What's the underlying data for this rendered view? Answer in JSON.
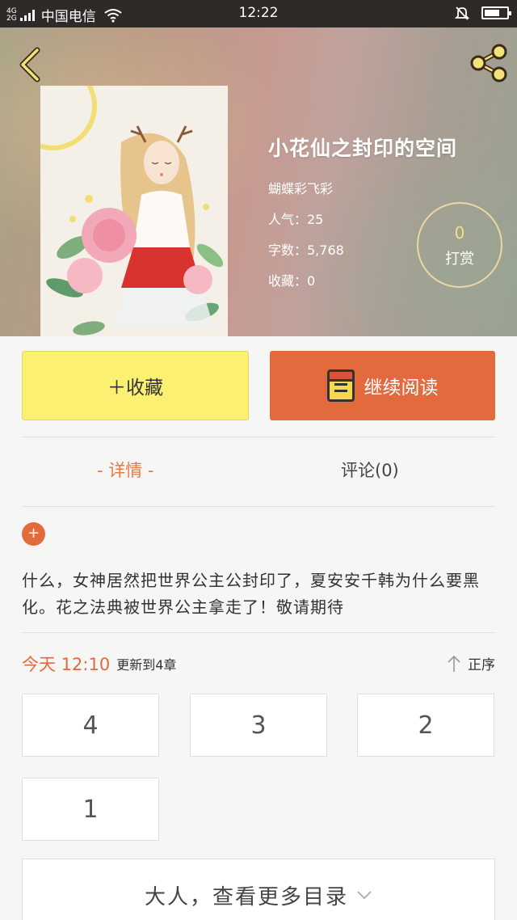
{
  "status_bar": {
    "network_top": "4G",
    "network_bottom": "2G",
    "carrier": "中国电信",
    "time": "12:22"
  },
  "header": {
    "back_icon": "chevron-left-icon",
    "share_icon": "share-icon"
  },
  "book": {
    "title": "小花仙之封印的空间",
    "author": "蝴蝶彩飞彩",
    "popularity": "人气：25",
    "word_count": "字数：5,768",
    "favorites": "收藏：0"
  },
  "reward": {
    "count": "0",
    "label": "打赏"
  },
  "actions": {
    "collect_label": "＋收藏",
    "read_label": "继续阅读"
  },
  "tabs": {
    "detail": "- 详情 -",
    "comments": "评论(0)"
  },
  "expand_icon": "+",
  "description": "什么，女神居然把世界公主公封印了，夏安安千韩为什么要黑化。花之法典被世界公主拿走了！敬请期待",
  "update": {
    "time": "今天 12:10",
    "text": "更新到4章",
    "sort_label": "正序"
  },
  "chapters": [
    "4",
    "3",
    "2",
    "1"
  ],
  "more_label": "大人，查看更多目录",
  "colors": {
    "accent": "#e36a3d",
    "collect_bg": "#fbf071",
    "reward_number": "#f4e084"
  }
}
